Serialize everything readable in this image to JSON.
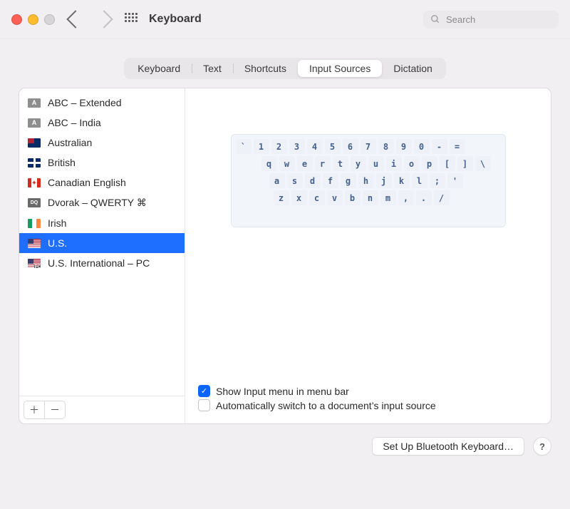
{
  "window": {
    "title": "Keyboard"
  },
  "search": {
    "placeholder": "Search"
  },
  "tabs": [
    {
      "label": "Keyboard"
    },
    {
      "label": "Text"
    },
    {
      "label": "Shortcuts"
    },
    {
      "label": "Input Sources",
      "active": true
    },
    {
      "label": "Dictation"
    }
  ],
  "sources": [
    {
      "label": "ABC – Extended",
      "flag": "letter",
      "badge": "A"
    },
    {
      "label": "ABC – India",
      "flag": "letter",
      "badge": "A"
    },
    {
      "label": "Australian",
      "flag": "au"
    },
    {
      "label": "British",
      "flag": "gb"
    },
    {
      "label": "Canadian English",
      "flag": "ca",
      "badge": "✦"
    },
    {
      "label": "Dvorak – QWERTY ⌘",
      "flag": "dq",
      "badge": "DQ"
    },
    {
      "label": "Irish",
      "flag": "ie"
    },
    {
      "label": "U.S.",
      "flag": "us",
      "selected": true
    },
    {
      "label": "U.S. International – PC",
      "flag": "usintl"
    }
  ],
  "keyboard_rows": [
    [
      "`",
      "1",
      "2",
      "3",
      "4",
      "5",
      "6",
      "7",
      "8",
      "9",
      "0",
      "-",
      "="
    ],
    [
      "q",
      "w",
      "e",
      "r",
      "t",
      "y",
      "u",
      "i",
      "o",
      "p",
      "[",
      "]",
      "\\"
    ],
    [
      "a",
      "s",
      "d",
      "f",
      "g",
      "h",
      "j",
      "k",
      "l",
      ";",
      "'"
    ],
    [
      "z",
      "x",
      "c",
      "v",
      "b",
      "n",
      "m",
      ",",
      ".",
      "/"
    ]
  ],
  "options": {
    "show_menu": {
      "label": "Show Input menu in menu bar",
      "checked": true
    },
    "auto_switch": {
      "label": "Automatically switch to a document’s input source",
      "checked": false
    }
  },
  "footer": {
    "bluetooth": "Set Up Bluetooth Keyboard…"
  }
}
